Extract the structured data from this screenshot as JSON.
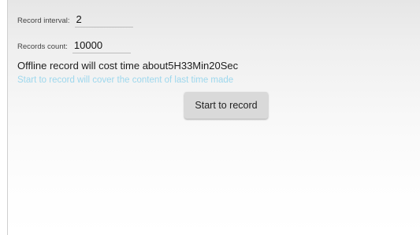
{
  "form": {
    "record_interval_label": "Record interval:",
    "record_interval_value": "2",
    "records_count_label": "Records count:",
    "records_count_value": "10000"
  },
  "messages": {
    "cost_time": "Offline record will cost time about5H33Min20Sec",
    "warning": "Start to record will cover the content of last time made"
  },
  "actions": {
    "start_label": "Start to record"
  },
  "colors": {
    "warning_text": "#8fd3ec",
    "button_bg": "#d9d9d9"
  }
}
